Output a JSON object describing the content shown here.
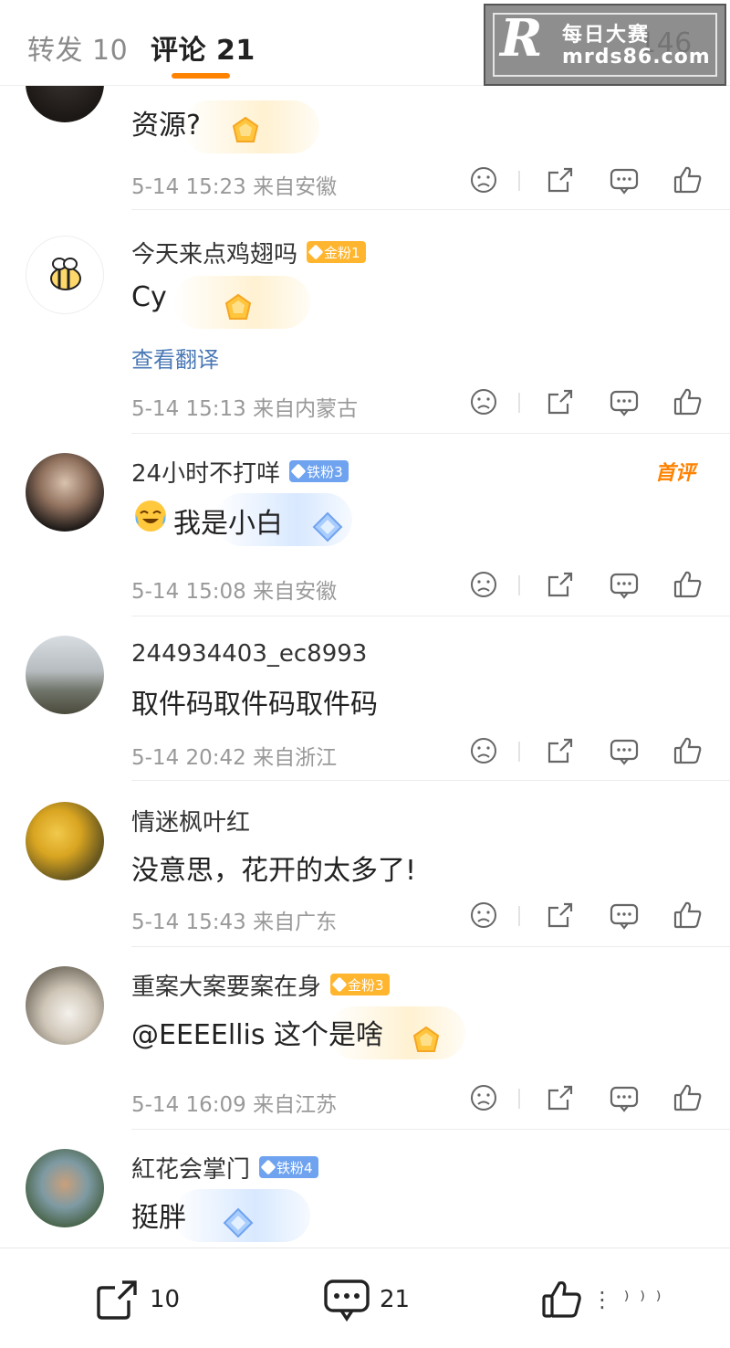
{
  "tabs": {
    "repost_label": "转发 10",
    "comment_label": "评论 21",
    "likes_label": "146"
  },
  "watermark": {
    "logo": "R",
    "title": "每日大赛",
    "url": "mrds86.com"
  },
  "comments": [
    {
      "name": "",
      "badge": "",
      "text": "资源?",
      "meta": "5-14 15:23 来自安徽"
    },
    {
      "name": "今天来点鸡翅吗",
      "badge": "金粉1",
      "text": "Cy",
      "translate": "查看翻译",
      "meta": "5-14 15:13 来自内蒙古"
    },
    {
      "name": "24小时不打咩",
      "badge": "铁粉3",
      "text": "我是小白",
      "first_tag": "首评",
      "meta": "5-14 15:08 来自安徽"
    },
    {
      "name": "244934403_ec8993",
      "text": "取件码取件码取件码",
      "meta": "5-14 20:42 来自浙江"
    },
    {
      "name": "情迷枫叶红",
      "text": "没意思，花开的太多了!",
      "meta": "5-14 15:43 来自广东"
    },
    {
      "name": "重案大案要案在身",
      "badge": "金粉3",
      "text": "@EEEEllis  这个是啥",
      "meta": "5-14 16:09 来自江苏"
    },
    {
      "name": "紅花会掌门",
      "badge": "铁粉4",
      "text": "挺胖"
    }
  ],
  "bottom": {
    "share_count": "10",
    "comment_count": "21"
  },
  "colors": {
    "accent": "#ff8200",
    "link": "#4a78b5",
    "meta": "#999999",
    "gold_badge": "#ffb52e",
    "iron_badge": "#6fa3ef"
  }
}
